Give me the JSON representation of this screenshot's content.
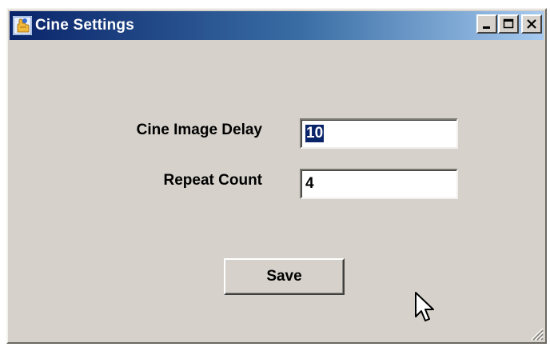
{
  "window": {
    "title": "Cine Settings",
    "icon": "app-hand-icon",
    "controls": [
      "minimize-icon",
      "maximize-icon",
      "close-icon"
    ]
  },
  "form": {
    "cine_image_delay": {
      "label": "Cine Image Delay",
      "value": "10"
    },
    "repeat_count": {
      "label": "Repeat Count",
      "value": "4"
    }
  },
  "actions": {
    "save_label": "Save"
  },
  "colors": {
    "titlebar_start": "#0a246a",
    "titlebar_end": "#a6caf0",
    "window_face": "#d6d2cb",
    "selection": "#0a246a"
  }
}
